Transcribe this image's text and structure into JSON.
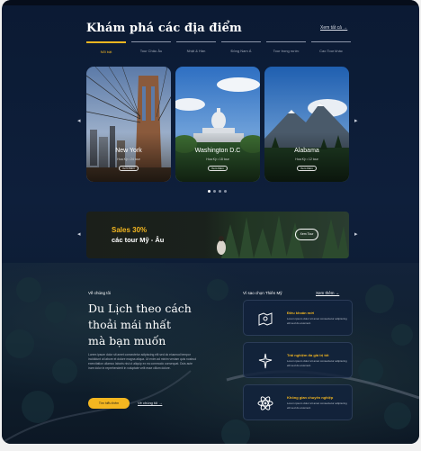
{
  "header": {
    "title": "Khám phá các địa điểm",
    "see_all": "Xem tất cả →"
  },
  "tabs": [
    {
      "label": "Nổi bật",
      "active": true
    },
    {
      "label": "Tour Châu Âu",
      "active": false
    },
    {
      "label": "Nhật & Hàn",
      "active": false
    },
    {
      "label": "Đông Nam Á",
      "active": false
    },
    {
      "label": "Tour trong nước",
      "active": false
    },
    {
      "label": "Cao Tour khác",
      "active": false
    }
  ],
  "destinations": [
    {
      "name": "New York",
      "subtitle": "Hoa Kỳ • 24 tour",
      "button": "Xem thêm"
    },
    {
      "name": "Washington D.C",
      "subtitle": "Hoa Kỳ • 18 tour",
      "button": "Xem thêm"
    },
    {
      "name": "Alabama",
      "subtitle": "Hoa Kỳ • 12 tour",
      "button": "Xem thêm"
    }
  ],
  "carousel": {
    "dot_count": 4,
    "active_index": 0
  },
  "banner": {
    "headline": "Sales 30%",
    "subline": "các tour Mỹ - Âu",
    "button": "Xem Tour"
  },
  "about": {
    "eyebrow": "Về chúng tôi",
    "heading_lines": [
      "Du Lịch theo cách",
      "thoải mái nhất",
      "mà bạn muốn"
    ],
    "paragraph": "Lorem ipsum dolor sit amet consectetur adipiscing elit sed do eiusmod tempor incididunt ut labore et dolore magna aliqua. Ut enim ad minim veniam quis nostrud exercitation ullamco laboris nisi ut aliquip ex ea commodo consequat. Duis aute irure dolor in reprehenderit in voluptate velit esse cillum dolore.",
    "primary_button": "Tìm hiểu thêm",
    "secondary_link": "Về chúng tôi →"
  },
  "why": {
    "label": "Vì sao chọn Thiên Mỹ",
    "link": "Xem thêm →",
    "features": [
      {
        "title": "Điều khoản mới",
        "desc": "Lorem ipsum dolor sit amet consectetur adipiscing elit sed do eiusmod.",
        "icon": "map-icon"
      },
      {
        "title": "Trải nghiệm đa giá trị tốt",
        "desc": "Lorem ipsum dolor sit amet consectetur adipiscing elit sed do eiusmod.",
        "icon": "sparkle-icon"
      },
      {
        "title": "Không gian chuyên nghiệp",
        "desc": "Lorem ipsum dolor sit amet consectetur adipiscing elit sed do eiusmod.",
        "icon": "atom-icon"
      }
    ]
  },
  "colors": {
    "accent": "#f3b620",
    "navy": "#0e1f3b"
  }
}
